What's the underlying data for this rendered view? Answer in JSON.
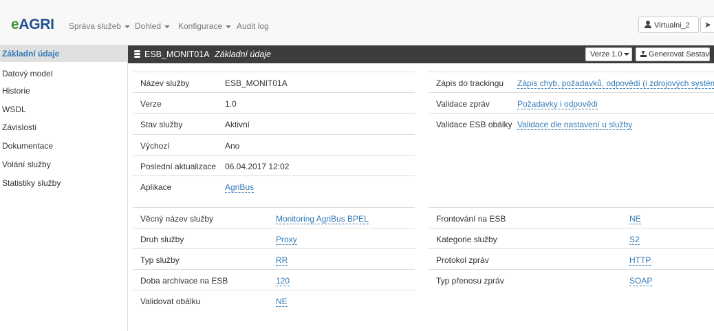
{
  "navbar": {
    "brand_e": "e",
    "brand_agri": "AGRI",
    "menu": [
      {
        "label": "Správa služeb",
        "has_caret": true
      },
      {
        "label": "Dohled",
        "has_caret": true
      },
      {
        "label": "Konfigurace",
        "has_caret": true
      },
      {
        "label": "Audit log",
        "has_caret": false
      }
    ],
    "user": "Virtualni_2"
  },
  "sidebar": {
    "items": [
      {
        "label": "Základní údaje",
        "active": true
      },
      {
        "label": "Datový model",
        "active": false
      },
      {
        "label": "Historie",
        "active": false
      },
      {
        "label": "WSDL",
        "active": false
      },
      {
        "label": "Závislosti",
        "active": false
      },
      {
        "label": "Dokumentace",
        "active": false
      },
      {
        "label": "Volání služby",
        "active": false
      },
      {
        "label": "Statistiky služby",
        "active": false
      }
    ]
  },
  "header": {
    "service_name": "ESB_MONIT01A",
    "section": "Základní údaje",
    "version_label": "Verze 1.0",
    "generate_label": "Generovat Sestavu"
  },
  "details_left": [
    {
      "label": "Název služby",
      "value": "ESB_MONIT01A",
      "link": false
    },
    {
      "label": "Verze",
      "value": "1.0",
      "link": false
    },
    {
      "label": "Stav služby",
      "value": "Aktivní",
      "link": false
    },
    {
      "label": "Výchozí",
      "value": "Ano",
      "link": false
    },
    {
      "label": "Poslední aktualizace",
      "value": "06.04.2017 12:02",
      "link": false
    },
    {
      "label": "Aplikace",
      "value": "AgriBus",
      "link": true
    }
  ],
  "details_right": [
    {
      "label": "Zápis do trackingu",
      "value": "Zápis chyb, požadavků, odpovědí (i zdrojových systémů)",
      "link": true
    },
    {
      "label": "Validace zpráv",
      "value": "Požadavky i odpovědi",
      "link": true
    },
    {
      "label": "Validace ESB obálky",
      "value": "Validace dle nastavení u služby",
      "link": true
    }
  ],
  "props_left": [
    {
      "label": "Věcný název služby",
      "value": "Monitoring AgriBus BPEL"
    },
    {
      "label": "Druh služby",
      "value": "Proxy"
    },
    {
      "label": "Typ služby",
      "value": "RR"
    },
    {
      "label": "Doba archivace na ESB",
      "value": "120"
    },
    {
      "label": "Validovat obálku",
      "value": "NE"
    }
  ],
  "props_right": [
    {
      "label": "Frontování na ESB",
      "value": "NE"
    },
    {
      "label": "Kategorie služby",
      "value": "S2"
    },
    {
      "label": "Protokol zpráv",
      "value": "HTTP"
    },
    {
      "label": "Typ přenosu zpráv",
      "value": "SOAP"
    }
  ],
  "colors": {
    "brand_green": "#3a9a2f",
    "brand_blue": "#1f4e8c",
    "header_bg": "#3d3d3d",
    "link": "#337ab7",
    "active_item_bg": "#e0e0e0"
  }
}
